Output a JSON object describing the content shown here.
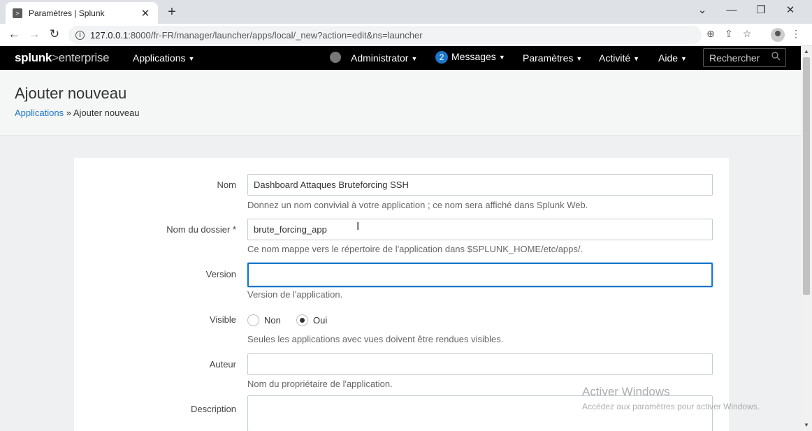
{
  "browser": {
    "tab_title": "Paramètres | Splunk",
    "tab_close": "✕",
    "new_tab": "+",
    "url_host": "127.0.0.1",
    "url_rest": ":8000/fr-FR/manager/launcher/apps/local/_new?action=edit&ns=launcher",
    "win_min": "—",
    "win_restore": "❐",
    "win_close": "✕",
    "back": "←",
    "forward": "→",
    "reload": "↻",
    "zoom": "⊕",
    "share": "⇪",
    "star": "☆",
    "menu": "⋮",
    "collapse": "⌄"
  },
  "splunk": {
    "logo_main": "splunk",
    "logo_sep": ">",
    "logo_ent": "enterprise",
    "nav": {
      "apps": "Applications",
      "admin": "Administrator",
      "messages_count": "2",
      "messages": "Messages",
      "settings": "Paramètres",
      "activity": "Activité",
      "help": "Aide"
    },
    "search_placeholder": "Rechercher",
    "caret": "▼"
  },
  "page": {
    "title": "Ajouter nouveau",
    "breadcrumb_link": "Applications",
    "breadcrumb_sep": " » ",
    "breadcrumb_current": "Ajouter nouveau"
  },
  "form": {
    "name_label": "Nom",
    "name_value": "Dashboard Attaques Bruteforcing SSH",
    "name_help": "Donnez un nom convivial à votre application ; ce nom sera affiché dans Splunk Web.",
    "folder_label": "Nom du dossier *",
    "folder_value": "brute_forcing_app",
    "folder_help": "Ce nom mappe vers le répertoire de l'application dans $SPLUNK_HOME/etc/apps/.",
    "version_label": "Version",
    "version_value": "",
    "version_help": "Version de l'application.",
    "visible_label": "Visible",
    "visible_no": "Non",
    "visible_yes": "Oui",
    "visible_selected": "Oui",
    "visible_help": "Seules les applications avec vues doivent être rendues visibles.",
    "author_label": "Auteur",
    "author_value": "",
    "author_help": "Nom du propriétaire de l'application.",
    "description_label": "Description"
  },
  "watermark": {
    "line1": "Activer Windows",
    "line2": "Accédez aux paramètres pour activer Windows."
  }
}
